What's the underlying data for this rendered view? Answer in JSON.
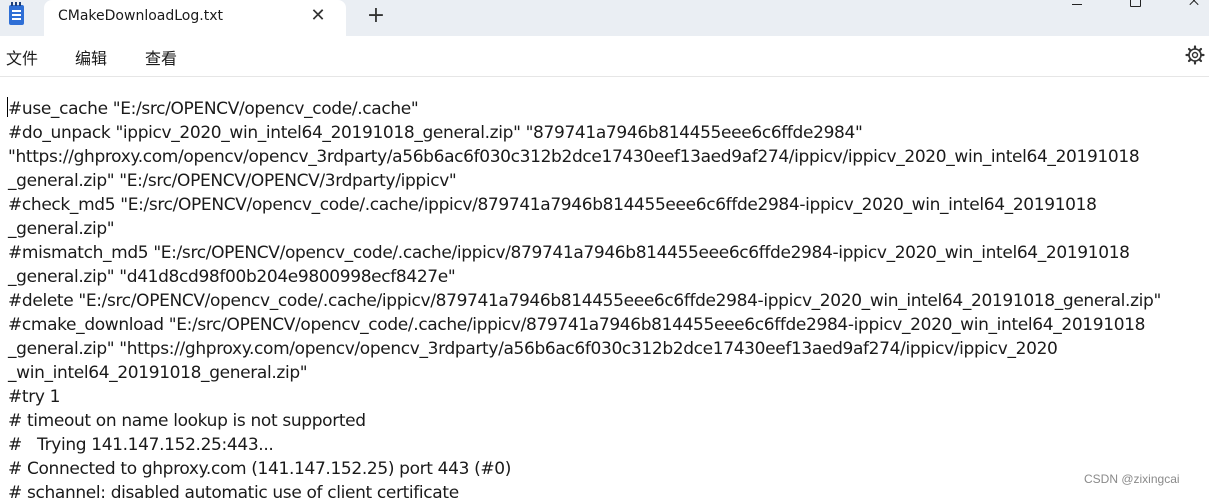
{
  "window": {
    "tab_title": "CMakeDownloadLog.txt",
    "close_tab_glyph": "✕",
    "new_tab_glyph": "+"
  },
  "menu": {
    "file": "文件",
    "edit": "编辑",
    "view": "查看"
  },
  "icons": {
    "app": "notepad-icon",
    "settings": "gear-icon"
  },
  "editor": {
    "lines": [
      "#use_cache \"E:/src/OPENCV/opencv_code/.cache\"",
      "#do_unpack \"ippicv_2020_win_intel64_20191018_general.zip\" \"879741a7946b814455eee6c6ffde2984\"",
      "\"https://ghproxy.com/opencv/opencv_3rdparty/a56b6ac6f030c312b2dce17430eef13aed9af274/ippicv/ippicv_2020_win_intel64_20191018",
      "_general.zip\" \"E:/src/OPENCV/OPENCV/3rdparty/ippicv\"",
      "#check_md5 \"E:/src/OPENCV/opencv_code/.cache/ippicv/879741a7946b814455eee6c6ffde2984-ippicv_2020_win_intel64_20191018",
      "_general.zip\"",
      "#mismatch_md5 \"E:/src/OPENCV/opencv_code/.cache/ippicv/879741a7946b814455eee6c6ffde2984-ippicv_2020_win_intel64_20191018",
      "_general.zip\" \"d41d8cd98f00b204e9800998ecf8427e\"",
      "#delete \"E:/src/OPENCV/opencv_code/.cache/ippicv/879741a7946b814455eee6c6ffde2984-ippicv_2020_win_intel64_20191018_general.zip\"",
      "#cmake_download \"E:/src/OPENCV/opencv_code/.cache/ippicv/879741a7946b814455eee6c6ffde2984-ippicv_2020_win_intel64_20191018",
      "_general.zip\" \"https://ghproxy.com/opencv/opencv_3rdparty/a56b6ac6f030c312b2dce17430eef13aed9af274/ippicv/ippicv_2020",
      "_win_intel64_20191018_general.zip\"",
      "#try 1",
      "# timeout on name lookup is not supported",
      "#   Trying 141.147.152.25:443...",
      "# Connected to ghproxy.com (141.147.152.25) port 443 (#0)",
      "# schannel: disabled automatic use of client certificate"
    ]
  },
  "watermark": "CSDN @zixingcai"
}
